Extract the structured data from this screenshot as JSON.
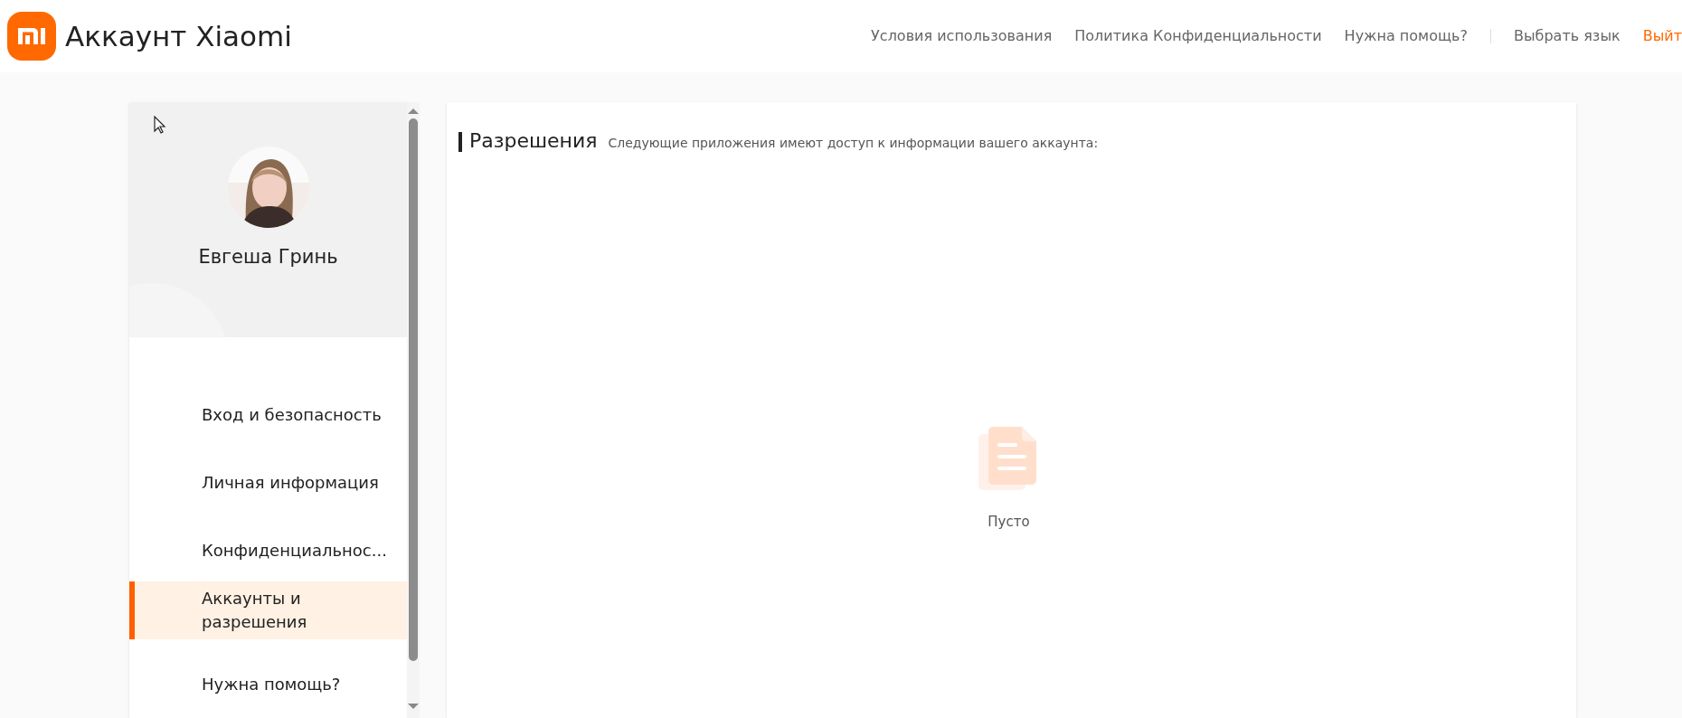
{
  "header": {
    "brand": "Аккаунт Xiaomi",
    "links": [
      {
        "label": "Условия использования",
        "kind": "link"
      },
      {
        "label": "Политика Конфиденциальности",
        "kind": "link"
      },
      {
        "label": "Нужна помощь?",
        "kind": "link"
      },
      {
        "label": "Выбрать язык",
        "kind": "link"
      },
      {
        "label": "Выйт",
        "kind": "logout"
      }
    ]
  },
  "sidebar": {
    "profile": {
      "name": "Евгеша Гринь"
    },
    "items": [
      {
        "label": "Вход и безопасность",
        "selected": false
      },
      {
        "label": "Личная информация",
        "selected": false
      },
      {
        "label": "Конфиденциальнос...",
        "selected": false
      },
      {
        "label": "Аккаунты и разрешения",
        "selected": true
      },
      {
        "label": "Нужна помощь?",
        "selected": false
      }
    ]
  },
  "main": {
    "title": "Разрешения",
    "subtitle": "Следующие приложения имеют доступ к информации вашего аккаунта:",
    "empty_text": "Пусто"
  }
}
